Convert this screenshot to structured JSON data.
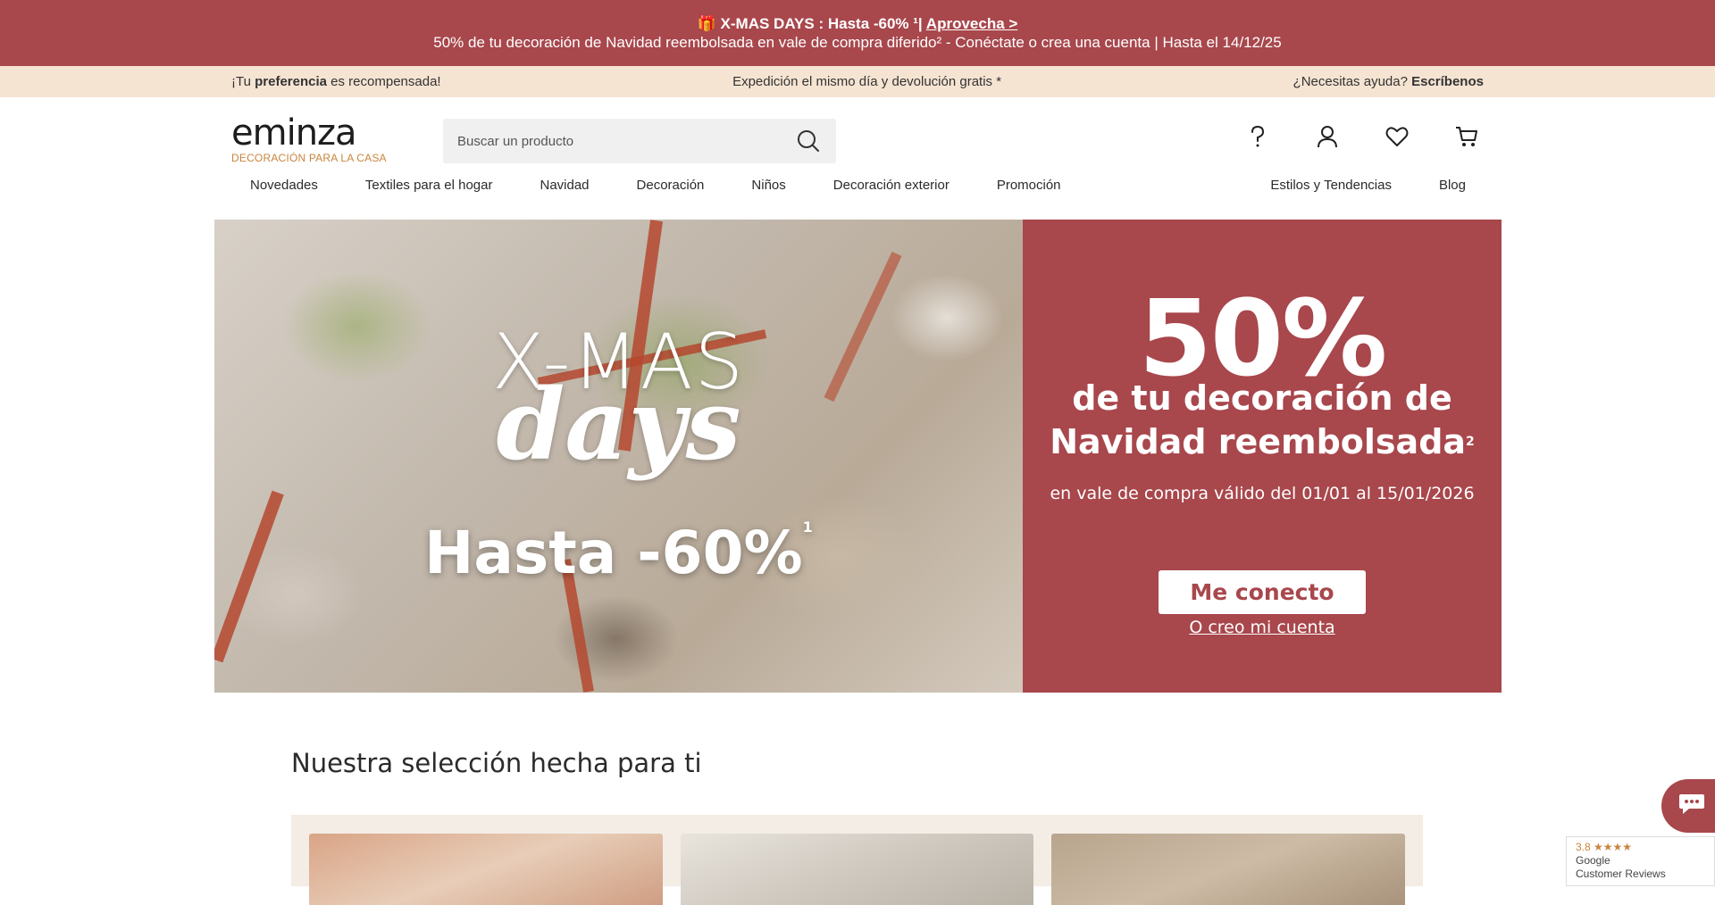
{
  "promo_top": {
    "line1_prefix": "🎁 X-MAS DAYS : Hasta -60% ¹|",
    "line1_link": "Aprovecha >",
    "line2": "50% de tu decoración de Navidad reembolsada en vale de compra diferido² - Conéctate o crea una cuenta | Hasta el 14/12/25"
  },
  "info_bar": {
    "left_pre": "¡Tu ",
    "left_bold": "preferencia",
    "left_post": " es recompensada!",
    "center": "Expedición el mismo día y devolución gratis *",
    "right_pre": "¿Necesitas ayuda? ",
    "right_bold": "Escríbenos"
  },
  "header": {
    "logo_word": "eminza",
    "logo_tagline": "DECORACIÓN PARA LA CASA",
    "search_placeholder": "Buscar un producto",
    "icons": [
      "help-icon",
      "account-icon",
      "wishlist-icon",
      "cart-icon"
    ]
  },
  "nav": {
    "left": [
      "Novedades",
      "Textiles para el hogar",
      "Navidad",
      "Decoración",
      "Niños",
      "Decoración exterior",
      "Promoción"
    ],
    "right": [
      "Estilos y Tendencias",
      "Blog"
    ]
  },
  "hero": {
    "xmas": "X-MAS",
    "days": "days",
    "hasta": "Hasta -60%",
    "hasta_sup": "1",
    "pct": "50%",
    "sub_line1": "de tu decoración de",
    "sub_line2": "Navidad reembolsada",
    "sub_sup": "2",
    "valid": "en vale de compra válido del 01/01 al 15/01/2026",
    "button": "Me conecto",
    "link": "O creo mi cuenta"
  },
  "section": {
    "title": "Nuestra selección hecha para ti"
  },
  "reviews": {
    "rating": "3.8",
    "stars": "★★★★",
    "line1": "Google",
    "line2": "Customer Reviews"
  },
  "colors": {
    "brand_red": "#a8474c",
    "info_bar": "#f6e4d3",
    "logo_tagline": "#c9843e"
  }
}
